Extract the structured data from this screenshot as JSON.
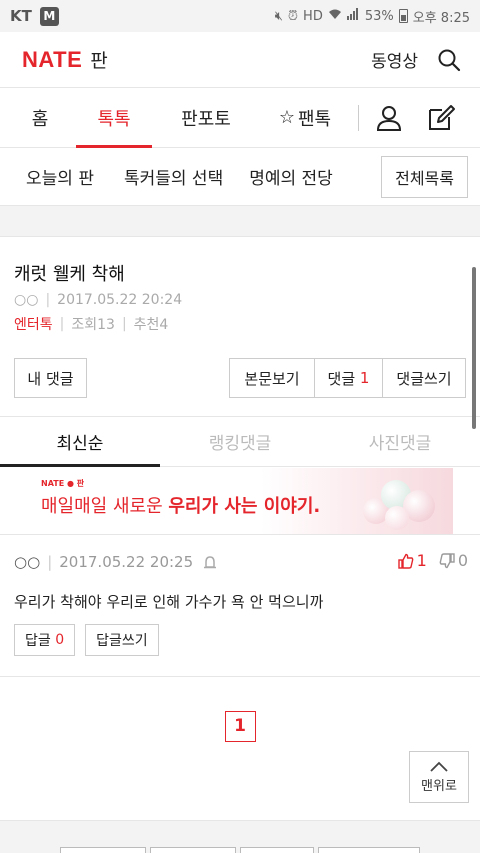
{
  "status_bar": {
    "carrier": "KT",
    "app_badge": "M",
    "battery": "53%",
    "time": "오후 8:25"
  },
  "header": {
    "logo": "NATE",
    "section": "판",
    "video_label": "동영상"
  },
  "nav": {
    "home": "홈",
    "toktok": "톡톡",
    "panpoto": "판포토",
    "pantok": "팬톡",
    "star": "☆"
  },
  "submenu": {
    "items": [
      "오늘의 판",
      "톡커들의 선택",
      "명예의 전당"
    ],
    "all": "전체목록"
  },
  "article": {
    "title": "캐럿 웰케 착해",
    "author": "○○",
    "date": "2017.05.22 20:24",
    "category": "엔터톡",
    "views": "조회13",
    "recommends": "추천4",
    "my_comments": "내 댓글",
    "view_body": "본문보기",
    "comments_label": "댓글",
    "comments_count": "1",
    "write_comment": "댓글쓰기"
  },
  "sort_tabs": [
    "최신순",
    "랭킹댓글",
    "사진댓글"
  ],
  "banner": {
    "logo": "NATE ● 판",
    "text_plain": "매일매일 새로운 ",
    "text_bold": "우리가 사는 이야기."
  },
  "comment": {
    "author": "○○",
    "date": "2017.05.22 20:25",
    "up": "1",
    "down": "0",
    "text": "우리가 착해야 우리로 인해 가수가 욕 안 먹으니까",
    "reply_label": "답글",
    "reply_count": "0",
    "write_reply": "답글쓰기"
  },
  "pagination": {
    "current": "1"
  },
  "to_top": "맨위로",
  "colors": {
    "accent": "#e4262c"
  }
}
